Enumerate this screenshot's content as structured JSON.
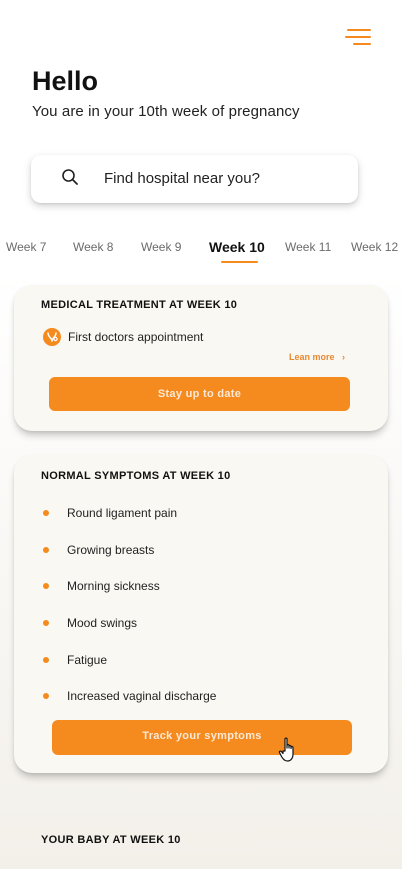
{
  "header": {
    "greeting": "Hello",
    "subtitle": "You are in your 10th week of pregnancy"
  },
  "search": {
    "text": "Find hospital near you?",
    "icon": "search-icon"
  },
  "weeks": {
    "items": [
      "Week 7",
      "Week 8",
      "Week 9",
      "Week 10",
      "Week 11",
      "Week 12"
    ],
    "active": "Week 10"
  },
  "medical_card": {
    "title": "MEDICAL TREATMENT AT WEEK 10",
    "item": "First doctors appointment",
    "item_icon": "doctor-icon",
    "link": "Lean more",
    "button": "Stay up to date"
  },
  "symptoms_card": {
    "title": "NORMAL SYMPTOMS AT WEEK 10",
    "items": [
      "Round ligament pain",
      "Growing breasts",
      "Morning sickness",
      "Mood swings",
      "Fatigue",
      "Increased vaginal discharge"
    ],
    "button": "Track your symptoms"
  },
  "baby_section": {
    "title": "YOUR BABY AT WEEK 10"
  },
  "colors": {
    "accent": "#f58a1f",
    "card": "#faf8f3"
  }
}
